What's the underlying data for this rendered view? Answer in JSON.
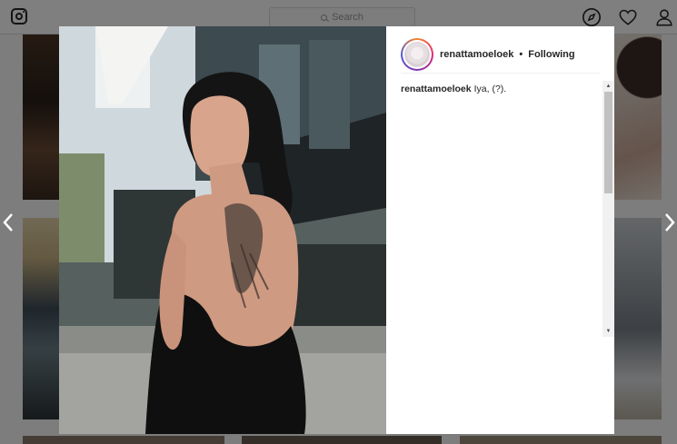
{
  "topbar": {
    "search_placeholder": "Search",
    "icons": [
      "instagram-logo-icon",
      "search-icon",
      "explore-compass-icon",
      "heart-icon",
      "profile-icon"
    ]
  },
  "navigation": {
    "prev_icon": "chevron-left-icon",
    "next_icon": "chevron-right-icon"
  },
  "post": {
    "username": "renattamoeloek",
    "separator": "•",
    "follow_status": "Following",
    "caption_user": "renattamoeloek",
    "caption_text": "Iya, (?)."
  },
  "colors": {
    "text": "#262626",
    "border": "#dbdbdb",
    "overlay": "rgba(0,0,0,0.5)",
    "scroll_track": "#f1f1f1",
    "scroll_thumb": "#c1c1c1"
  }
}
